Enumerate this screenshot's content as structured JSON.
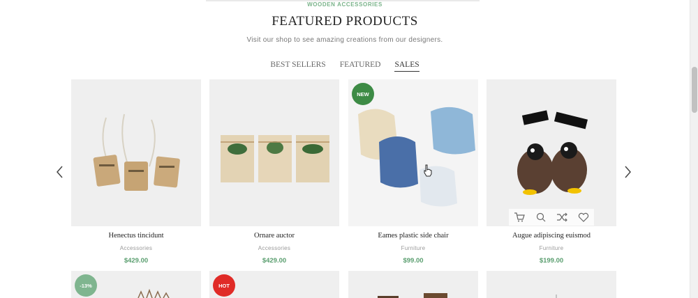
{
  "section_label": "WOODEN ACCESSORIES",
  "heading": "FEATURED PRODUCTS",
  "subheading": "Visit our shop to see amazing creations from our designers.",
  "tabs": [
    {
      "label": "BEST SELLERS"
    },
    {
      "label": "FEATURED"
    },
    {
      "label": "SALES"
    }
  ],
  "products": [
    {
      "name": "Henectus tincidunt",
      "category": "Accessories",
      "price": "$429.00",
      "badge": ""
    },
    {
      "name": "Ornare auctor",
      "category": "Accessories",
      "price": "$429.00",
      "badge": ""
    },
    {
      "name": "Eames plastic side chair",
      "category": "Furniture",
      "price": "$99.00",
      "badge": "NEW"
    },
    {
      "name": "Augue adipiscing euismod",
      "category": "Furniture",
      "price": "$199.00",
      "badge": ""
    }
  ],
  "next_row_badges": [
    "-13%",
    "HOT"
  ],
  "colors": {
    "accent": "#5a9e6f",
    "badge_new": "#3d8b45",
    "badge_sale": "#7fb58f",
    "badge_hot": "#e02b27"
  },
  "icons": {
    "prev": "chevron-left-icon",
    "next": "chevron-right-icon",
    "actions": [
      "cart-icon",
      "search-icon",
      "shuffle-icon",
      "heart-icon"
    ]
  }
}
